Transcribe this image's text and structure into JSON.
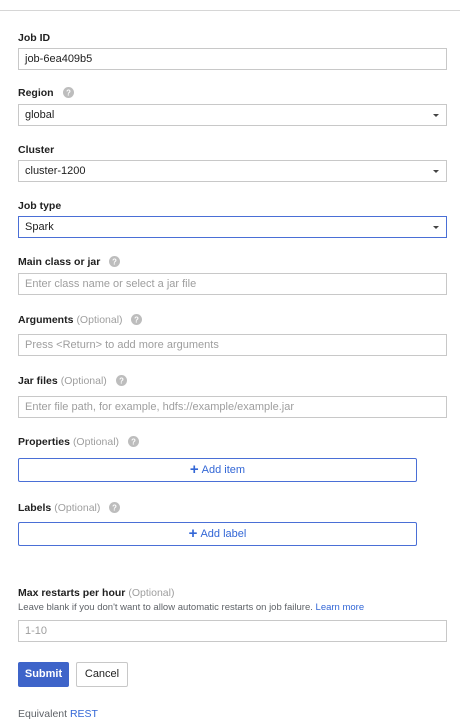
{
  "form": {
    "job_id": {
      "label": "Job ID",
      "value": "job-6ea409b5"
    },
    "region": {
      "label": "Region",
      "value": "global"
    },
    "cluster": {
      "label": "Cluster",
      "value": "cluster-1200"
    },
    "job_type": {
      "label": "Job type",
      "value": "Spark"
    },
    "main_class": {
      "label": "Main class or jar",
      "placeholder": "Enter class name or select a jar file"
    },
    "arguments": {
      "label": "Arguments",
      "optional": "(Optional)",
      "placeholder": "Press <Return> to add more arguments"
    },
    "jar_files": {
      "label": "Jar files",
      "optional": "(Optional)",
      "placeholder": "Enter file path, for example, hdfs://example/example.jar"
    },
    "properties": {
      "label": "Properties",
      "optional": "(Optional)",
      "button_label": "Add item"
    },
    "labels": {
      "label": "Labels",
      "optional": "(Optional)",
      "button_label": "Add label"
    },
    "max_restarts": {
      "label": "Max restarts per hour",
      "optional": "(Optional)",
      "hint": "Leave blank if you don't want to allow automatic restarts on job failure.",
      "hint_link": "Learn more",
      "placeholder": "1-10"
    }
  },
  "actions": {
    "submit_label": "Submit",
    "cancel_label": "Cancel"
  },
  "footer": {
    "equivalent_text": "Equivalent",
    "rest_link": "REST"
  },
  "icons": {
    "help": "help-circle-icon",
    "dropdown": "chevron-down-icon",
    "plus": "plus-icon"
  },
  "colors": {
    "accent": "#3367d6",
    "submit_bg": "#3e64c9",
    "border": "#c8c8c8",
    "placeholder": "#9e9e9e"
  }
}
